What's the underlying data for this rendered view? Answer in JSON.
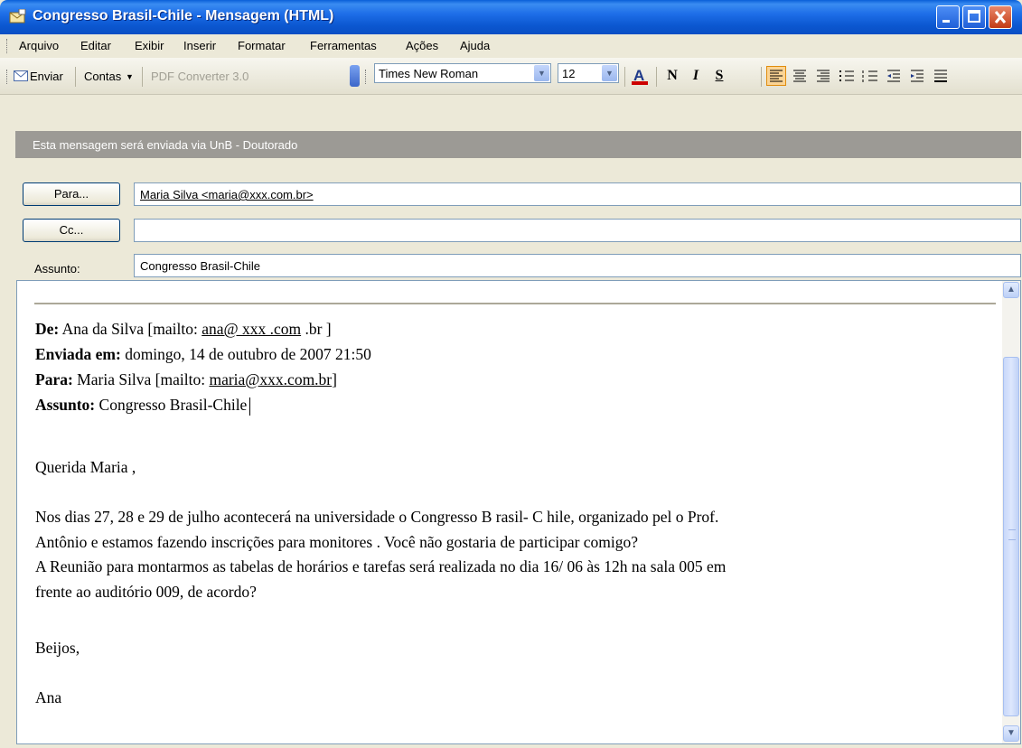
{
  "window": {
    "title": "Congresso  Brasil-Chile - Mensagem (HTML)"
  },
  "menu": {
    "items": [
      "Arquivo",
      "Editar",
      "Exibir",
      "Inserir",
      "Formatar",
      "Ferramentas",
      "Ações",
      "Ajuda"
    ]
  },
  "toolbar": {
    "send_label": "Enviar",
    "accounts_label": "Contas",
    "pdf_label": "PDF Converter 3.0",
    "font_name": "Times New Roman",
    "font_size": "12",
    "bold_label": "N",
    "italic_label": "I",
    "underline_label": "S",
    "font_color": "#cc0000"
  },
  "banner": {
    "text": "Esta mensagem será enviada via UnB - Doutorado"
  },
  "header": {
    "to_button": "Para...",
    "to_value": "Maria Silva  <maria@xxx.com.br>",
    "cc_button": "Cc...",
    "cc_value": "",
    "subject_label": "Assunto:",
    "subject_value": "Congresso  Brasil-Chile"
  },
  "message": {
    "from_label": "De:",
    "from_name": " Ana da Silva [mailto: ",
    "from_email": "ana@ xxx .com",
    "from_tail": " .br ]",
    "sent_label": "Enviada em:",
    "sent_value": " domingo, 14 de outubro de 2007 21:50",
    "to_label": "Para:",
    "to_name": " Maria Silva [mailto: ",
    "to_email": "maria@xxx.com.br",
    "to_tail": "]",
    "subject_label": "Assunto:",
    "subject_value": " Congresso Brasil-Chile",
    "greeting": "Querida Maria ,",
    "para1_line1": "Nos dias  27,  28 e  29  de  julho   acontecerá  na  universidade  o  Congresso  B rasil-  C hile,  organizado  pel o  Prof.",
    "para1_line2": "Antônio e estamos fazendo  inscrições para monitores . Você não gostaria de participar comigo?",
    "para2_line1": "A Reunião para montarmos as tabelas de horários e tarefas será realizada no dia 16/ 06   às 12h  na sala 005 em",
    "para2_line2": "frente ao auditório 009, de acordo?",
    "closing": "Beijos,",
    "signature": "Ana"
  }
}
